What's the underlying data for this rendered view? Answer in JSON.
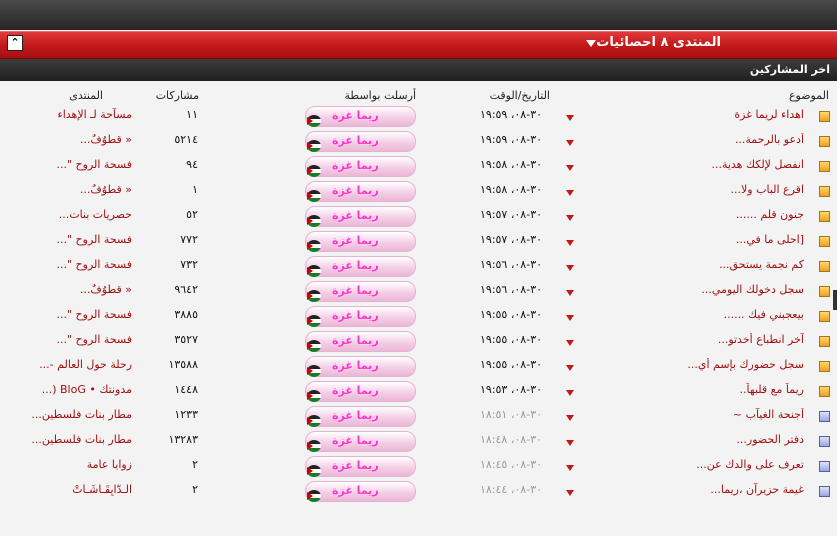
{
  "forum_title": "المنتدى ٨ احصائيات",
  "section_title": "اخر المشاركين",
  "columns": {
    "subject": "الموضوع",
    "datetime": "التاريخ/الوقت",
    "sent_by": "أرسلت بواسطة",
    "posts": "مشاركات",
    "forum": "المنتدى"
  },
  "rows": [
    {
      "subject": "اهداء لريما غزة",
      "date": "٣٠-٠٨، ١٩:٥٩",
      "user": "ريما غزة",
      "posts": "١١",
      "forum": "مسآحة لـ الإهداء",
      "old": false
    },
    {
      "subject": "أدعو بالرحمة...",
      "date": "٣٠-٠٨، ١٩:٥٩",
      "user": "ريما غزة",
      "posts": "٥٢١٤",
      "forum": "« قطوُفٌ...",
      "old": false
    },
    {
      "subject": "انفصل لإلكك هدية...",
      "date": "٣٠-٠٨، ١٩:٥٨",
      "user": "ريما غزة",
      "posts": "٩٤",
      "forum": "فسحة الروح \"...",
      "old": false
    },
    {
      "subject": "اقرع الباب ولا...",
      "date": "٣٠-٠٨، ١٩:٥٨",
      "user": "ريما غزة",
      "posts": "١",
      "forum": "« قطوُفٌ...",
      "old": false
    },
    {
      "subject": "جنون قلم ......",
      "date": "٣٠-٠٨، ١٩:٥٧",
      "user": "ريما غزة",
      "posts": "٥٢",
      "forum": "حصريات بنات...",
      "old": false
    },
    {
      "subject": "[احلى ما في...",
      "date": "٣٠-٠٨، ١٩:٥٧",
      "user": "ريما غزة",
      "posts": "٧٧٢",
      "forum": "فسحة الروح \"...",
      "old": false
    },
    {
      "subject": "كم نجمة يستحق...",
      "date": "٣٠-٠٨، ١٩:٥٦",
      "user": "ريما غزة",
      "posts": "٧٣٢",
      "forum": "فسحة الروح \"...",
      "old": false
    },
    {
      "subject": "سجل دخولك اليومي...",
      "date": "٣٠-٠٨، ١٩:٥٦",
      "user": "ريما غزة",
      "posts": "٩٦٤٢",
      "forum": "« قطوُفٌ...",
      "old": false
    },
    {
      "subject": "بيعجبني فيك ......",
      "date": "٣٠-٠٨، ١٩:٥٥",
      "user": "ريما غزة",
      "posts": "٣٨٨٥",
      "forum": "فسحة الروح \"...",
      "old": false
    },
    {
      "subject": "آخر انطباع أخدتو...",
      "date": "٣٠-٠٨، ١٩:٥٥",
      "user": "ريما غزة",
      "posts": "٣٥٢٧",
      "forum": "فسحة الروح \"...",
      "old": false
    },
    {
      "subject": "سجل حضورك بإسم أي...",
      "date": "٣٠-٠٨، ١٩:٥٥",
      "user": "ريما غزة",
      "posts": "١٣٥٨٨",
      "forum": "رحلة حول العالم -...",
      "old": false
    },
    {
      "subject": "ريماً مع قلبهاً..",
      "date": "٣٠-٠٨، ١٩:٥٣",
      "user": "ريما غزة",
      "posts": "١٤٤٨",
      "forum": "مدونتك • BloG (...",
      "old": false
    },
    {
      "subject": "أجنحة الغيآب ~",
      "date": "٣٠-٠٨، ١٨:٥١",
      "user": "ريما غزة",
      "posts": "١٢٣٣",
      "forum": "مطار بنات فلسطين...",
      "old": true
    },
    {
      "subject": "دفتر الحضور...",
      "date": "٣٠-٠٨، ١٨:٤٨",
      "user": "ريما غزة",
      "posts": "١٣٢٨٣",
      "forum": "مطار بنات فلسطين...",
      "old": true
    },
    {
      "subject": "تعرف على والدك عن...",
      "date": "٣٠-٠٨، ١٨:٤٥",
      "user": "ريما غزة",
      "posts": "٢",
      "forum": "زوايا عامة",
      "old": true
    },
    {
      "subject": "غيمة حزيرآن ،ريما...",
      "date": "٣٠-٠٨، ١٨:٤٤",
      "user": "ريما غزة",
      "posts": "٢",
      "forum": "الـدّايِقَـاشَـاتْ",
      "old": true
    }
  ]
}
